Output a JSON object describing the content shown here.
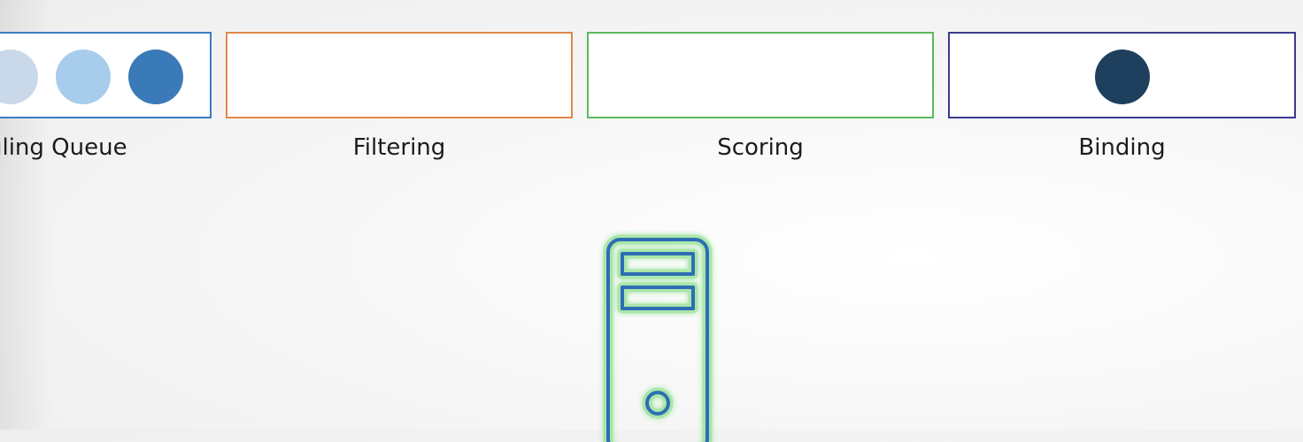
{
  "stages": {
    "queue": {
      "label": "uling Queue",
      "border_color": "#3a7cc0"
    },
    "filter": {
      "label": "Filtering",
      "border_color": "#e0874a"
    },
    "score": {
      "label": "Scoring",
      "border_color": "#5cb85c"
    },
    "binding": {
      "label": "Binding",
      "border_color": "#3b3b8f"
    }
  },
  "pods": {
    "queue_pod_colors": [
      "#c9d9ea",
      "#a8ccec",
      "#3a7ab8"
    ],
    "binding_pod_color": "#1f3f5f"
  },
  "server": {
    "stroke_color": "#2e6db4",
    "glow_color": "#7ddc7d",
    "icon": "server-icon"
  }
}
